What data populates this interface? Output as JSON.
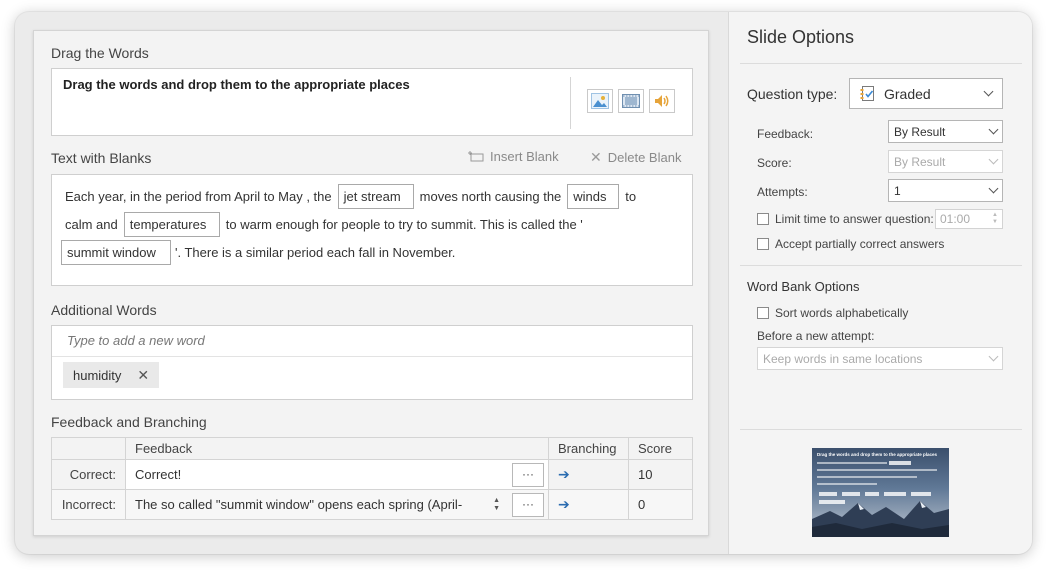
{
  "editor": {
    "question_section_title": "Drag the Words",
    "question_text": "Drag the words and drop them to the appropriate places",
    "media_buttons": [
      {
        "icon": "image-icon"
      },
      {
        "icon": "video-icon"
      },
      {
        "icon": "audio-icon"
      }
    ],
    "blanks_section_title": "Text with Blanks",
    "insert_blank_label": "Insert Blank",
    "delete_blank_label": "Delete Blank",
    "text_line1": {
      "t1": "Each year, in the period from April to May , the",
      "b1": "jet stream",
      "t2": "moves north causing the",
      "b2": "winds",
      "t3": "to"
    },
    "text_line2": {
      "t1": "calm and",
      "b1": "temperatures",
      "t2": "to warm enough for people to try to summit. This is called the '"
    },
    "text_line3": {
      "b1": "summit window",
      "t1": "'. There is a similar period each fall in November."
    },
    "additional_section_title": "Additional Words",
    "additional_placeholder": "Type to add a new word",
    "additional_words": [
      "humidity"
    ],
    "feedback_section_title": "Feedback and Branching",
    "table_headers": {
      "feedback": "Feedback",
      "branching": "Branching",
      "score": "Score"
    },
    "rows": [
      {
        "label": "Correct:",
        "feedback": "Correct!",
        "score": "10"
      },
      {
        "label": "Incorrect:",
        "feedback": "The so called \"summit window\" opens each spring (April-",
        "score": "0"
      }
    ]
  },
  "sidebar": {
    "title": "Slide Options",
    "question_type_label": "Question type:",
    "question_type_value": "Graded",
    "feedback_label": "Feedback:",
    "feedback_value": "By Result",
    "score_label": "Score:",
    "score_value": "By Result",
    "attempts_label": "Attempts:",
    "attempts_value": "1",
    "limit_time_label": "Limit time to answer question:",
    "limit_time_value": "01:00",
    "partial_label": "Accept partially correct answers",
    "word_bank_title": "Word Bank Options",
    "sort_label": "Sort words alphabetically",
    "before_attempt_label": "Before a new attempt:",
    "before_attempt_value": "Keep words in same locations",
    "thumbnail_title": "Drag the words and drop them to the appropriate places"
  }
}
